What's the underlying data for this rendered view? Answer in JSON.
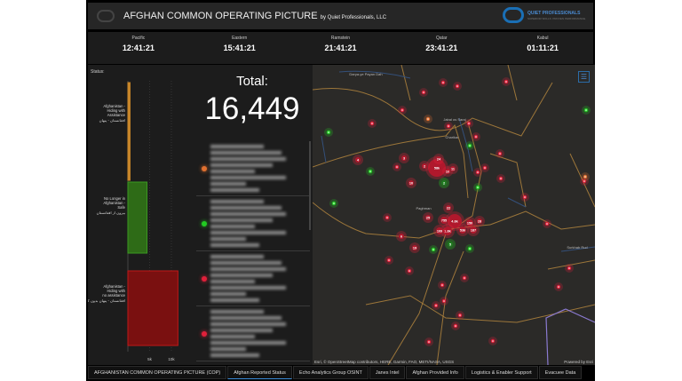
{
  "header": {
    "title": "AFGHAN COMMON OPERATING PICTURE",
    "byline": "by Quiet Professionals, LLC",
    "brand": "QUIET PROFESSIONALS",
    "brand_sub": "SUPERIOR SKILLS. PROVEN PERFORMANCE."
  },
  "clocks": [
    {
      "zone": "Pacific",
      "time": "12:41:21"
    },
    {
      "zone": "Eastern",
      "time": "15:41:21"
    },
    {
      "zone": "Ramstein",
      "time": "21:41:21"
    },
    {
      "zone": "Qatar",
      "time": "23:41:21"
    },
    {
      "zone": "Kabul",
      "time": "01:11:21"
    }
  ],
  "status_label": "Status:",
  "chart_data": {
    "type": "bar",
    "orientation": "horizontal",
    "categories": [
      "Afghanistan - Hiding with Assistance",
      "No Longer in Afghanistan - Safe",
      "Afghanistan - Hiding with no assistance"
    ],
    "category_labels_fa": [
      "افغانستان - پنهان",
      "بیرون از افغانستان",
      "افغانستان - پنهان بدون کمک"
    ],
    "values": [
      500,
      4400,
      11500
    ],
    "colors": [
      "#c8862a",
      "#2e6b17",
      "#7a1010"
    ],
    "xticks": [
      "5k",
      "10k"
    ],
    "xlim": [
      0,
      12000
    ]
  },
  "total": {
    "label": "Total:",
    "value": "16,449"
  },
  "list_dots": [
    "#e07030",
    "#22cc22",
    "#e0203a",
    "#e0203a"
  ],
  "map": {
    "places": [
      "Darya-ye Payan Dah",
      "Jabal os Saraj",
      "Charikar",
      "Paghman",
      "Kabul",
      "Surkhab Rud"
    ],
    "clusters": [
      "58k",
      "4.8k",
      "1.8k",
      "755",
      "150",
      "536",
      "187",
      "109",
      "25",
      "22",
      "24",
      "10",
      "28",
      "11",
      "19",
      "10",
      "4",
      "2",
      "3",
      "6",
      "5",
      "2"
    ],
    "attribution": "Esri, © OpenStreetMap contributors, HERE, Garmin, FAO, METI/NASA, USGS",
    "powered": "Powered by Esri"
  },
  "tabs": [
    "AFGHANISTAN COMMON OPERATING PICTURE (COP)",
    "Afghan Reported Status",
    "Echo Analytics Group OSINT",
    "Janes Intel",
    "Afghan Provided Info",
    "Logistics & Enabler Support",
    "Evacuee Data"
  ],
  "active_tab": 1,
  "colors": {
    "red": "#e0203a",
    "green": "#22cc22",
    "orange": "#e07030",
    "road": "#b98a3e",
    "river": "#34507a"
  }
}
